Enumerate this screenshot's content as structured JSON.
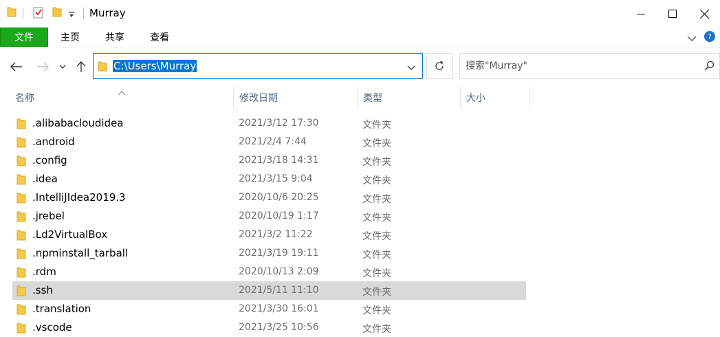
{
  "window": {
    "title": "Murray",
    "minimize_glyph": "—",
    "maximize_glyph": "☐",
    "close_glyph": "✕"
  },
  "ribbon": {
    "tabs": [
      {
        "label": "文件",
        "active": true
      },
      {
        "label": "主页"
      },
      {
        "label": "共享"
      },
      {
        "label": "查看"
      }
    ]
  },
  "address_bar": {
    "path": "C:\\Users\\Murray"
  },
  "search": {
    "placeholder": "搜索\"Murray\""
  },
  "columns": [
    {
      "label": "名称"
    },
    {
      "label": "修改日期"
    },
    {
      "label": "类型"
    },
    {
      "label": "大小"
    }
  ],
  "files": [
    {
      "name": ".alibabacloudidea",
      "modified": "2021/3/12 17:30",
      "type": "文件夹"
    },
    {
      "name": ".android",
      "modified": "2021/2/4 7:44",
      "type": "文件夹"
    },
    {
      "name": ".config",
      "modified": "2021/3/18 14:31",
      "type": "文件夹"
    },
    {
      "name": ".idea",
      "modified": "2021/3/15 9:04",
      "type": "文件夹"
    },
    {
      "name": ".IntelliJIdea2019.3",
      "modified": "2020/10/6 20:25",
      "type": "文件夹"
    },
    {
      "name": ".jrebel",
      "modified": "2020/10/19 1:17",
      "type": "文件夹"
    },
    {
      "name": ".Ld2VirtualBox",
      "modified": "2021/3/2 11:22",
      "type": "文件夹"
    },
    {
      "name": ".npminstall_tarball",
      "modified": "2021/3/19 19:11",
      "type": "文件夹"
    },
    {
      "name": ".rdm",
      "modified": "2020/10/13 2:09",
      "type": "文件夹"
    },
    {
      "name": ".ssh",
      "modified": "2021/5/11 11:10",
      "type": "文件夹",
      "selected": true
    },
    {
      "name": ".translation",
      "modified": "2021/3/30 16:01",
      "type": "文件夹"
    },
    {
      "name": ".vscode",
      "modified": "2021/3/25 10:56",
      "type": "文件夹"
    }
  ],
  "colors": {
    "file_tab": "#19a919",
    "accent": "#0078d7",
    "folder": "#f5c94a",
    "selection": "#d9d9d9"
  }
}
